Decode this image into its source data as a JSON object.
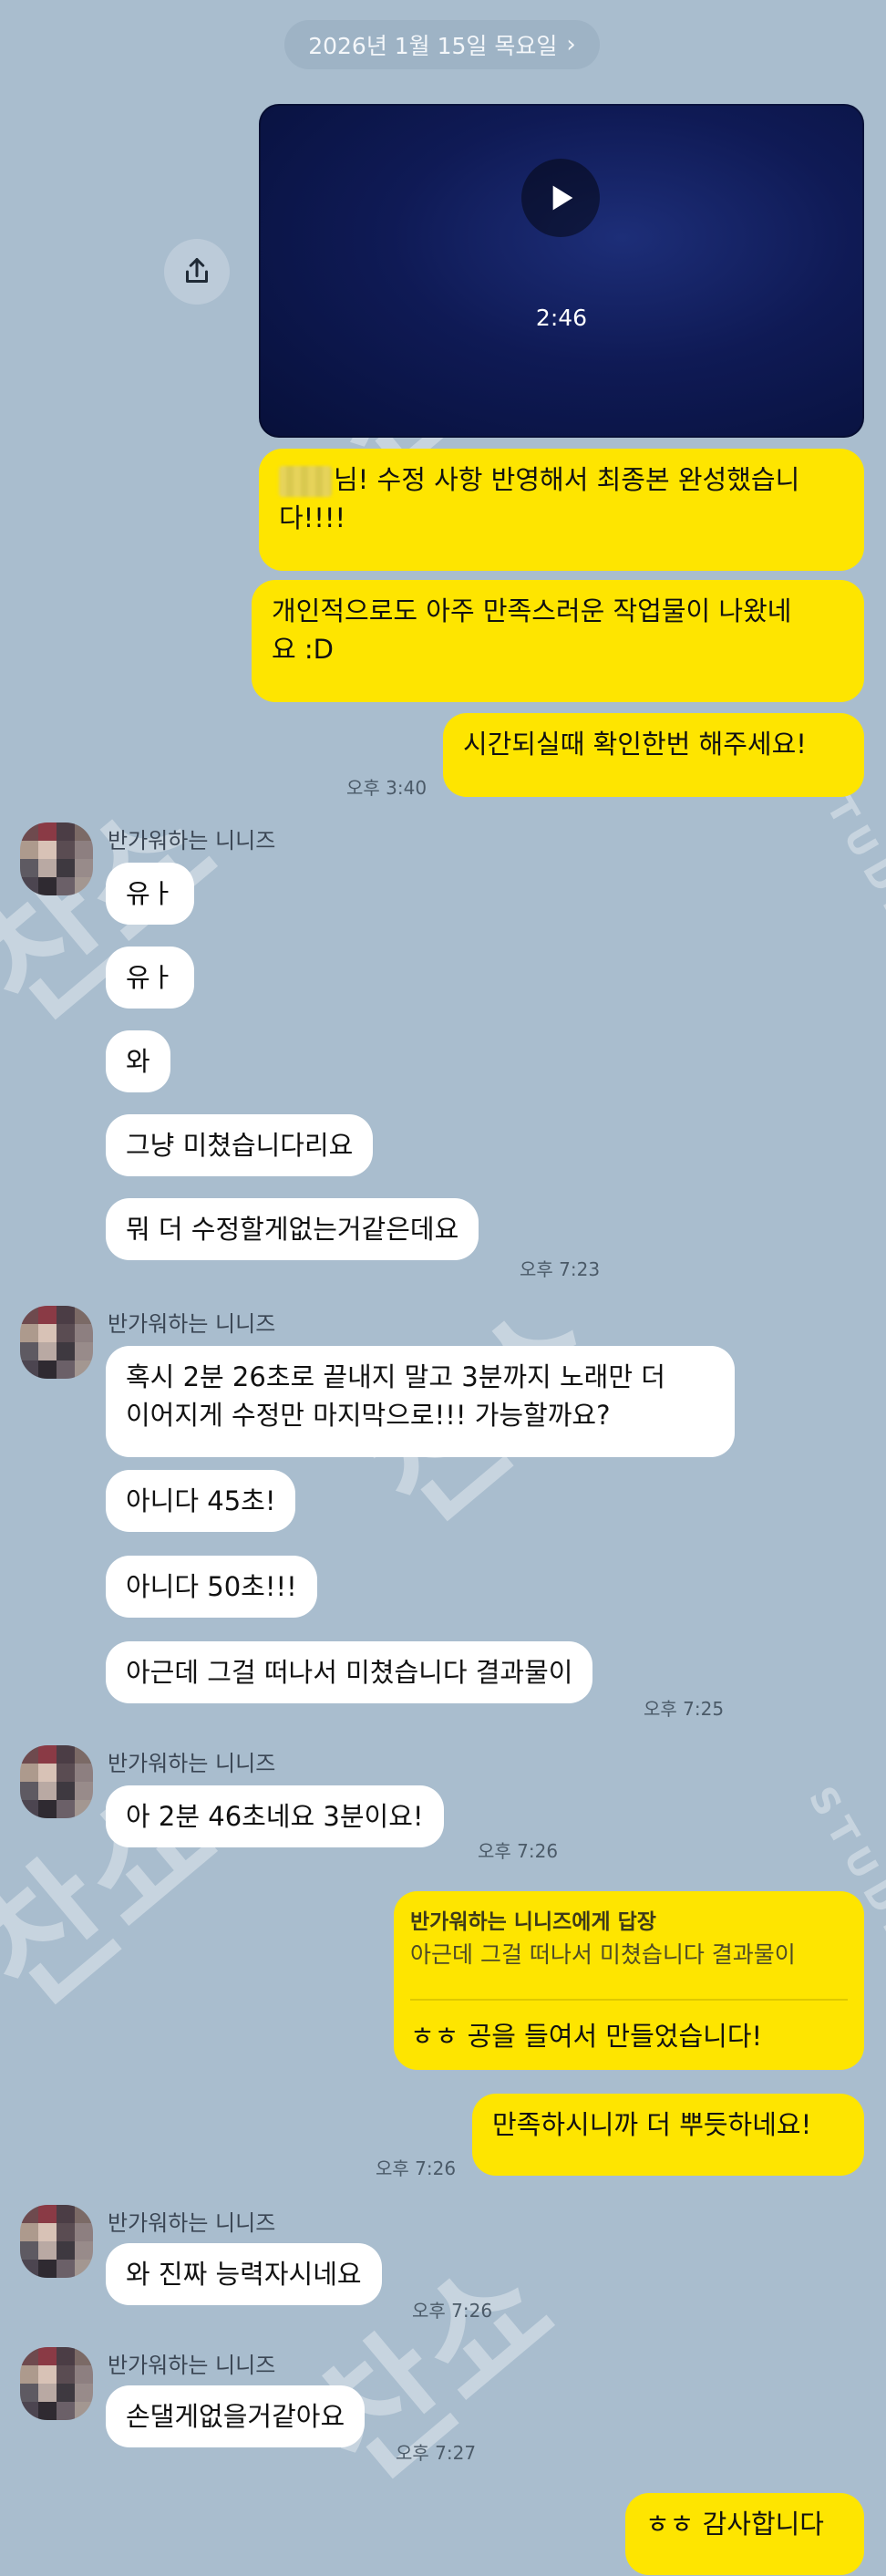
{
  "header": {
    "date": "2026년 1월 15일 목요일",
    "chevron_icon": "chevron-right-icon"
  },
  "video": {
    "duration": "2:46"
  },
  "sender_name": "반가워하는 니니즈",
  "messages": {
    "me1_line1": "님! 수정 사항 반영해서 최종본 완성했습니",
    "me1_line2": "다!!!!",
    "me2_line1": "개인적으로도 아주 만족스러운 작업물이 나왔네",
    "me2_line2": "요 :D",
    "me3": "시간되실때 확인한번 해주세요!",
    "me3_time": "오후 3:40",
    "t1": "유ㅏ",
    "t2": "유ㅏ",
    "t3": "와",
    "t4": "그냥 미쳤습니다리요",
    "t5": "뭐 더 수정할게없는거같은데요",
    "t5_time": "오후 7:23",
    "t6_line1": "혹시 2분 26초로 끝내지 말고 3분까지 노래만 더",
    "t6_line2": "이어지게 수정만 마지막으로!!! 가능할까요?",
    "t7": "아니다 45초!",
    "t8": "아니다 50초!!!",
    "t9": "아근데 그걸 떠나서 미쳤습니다 결과물이",
    "t9_time": "오후 7:25",
    "t10": "아 2분 46초네요 3분이요!",
    "t10_time": "오후 7:26",
    "reply_head": "반가워하는 니니즈에게 답장",
    "reply_quote": "아근데 그걸 떠나서 미쳤습니다 결과물이",
    "reply_text": "ㅎㅎ 공을 들여서 만들었습니다!",
    "me4": "만족하시니까 더 뿌듯하네요!",
    "me4_time": "오후 7:26",
    "t11": "와 진짜 능력자시네요",
    "t11_time": "오후 7:26",
    "t12": "손댈게없을거같아요",
    "t12_time": "오후 7:27",
    "me5": "ㅎㅎ 감사합니다"
  },
  "watermark": {
    "text": "찬쇼",
    "sub": "STUDIO"
  },
  "colors": {
    "background": "#a9bdce",
    "my_bubble": "#fee500",
    "their_bubble": "#ffffff"
  }
}
